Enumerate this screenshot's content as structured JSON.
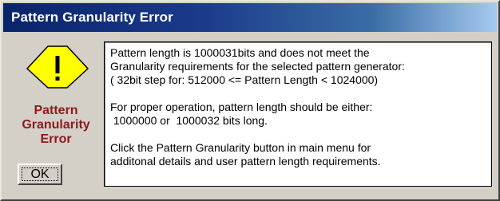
{
  "window": {
    "title": "Pattern Granularity Error"
  },
  "icon": {
    "name": "warning-icon",
    "color": "#ffff00"
  },
  "side_label": "Pattern\nGranularity\nError",
  "ok_button": {
    "label": "OK"
  },
  "message": {
    "paragraph1": [
      "Pattern length is 1000031bits and does not meet the",
      "Granularity requirements for the selected pattern generator:",
      "( 32bit step for: 512000 <= Pattern Length < 1024000)"
    ],
    "paragraph2": [
      "For proper operation, pattern length should be either:",
      " 1000000 or  1000032 bits long."
    ],
    "paragraph3": [
      "Click the Pattern Granularity button in main menu for",
      "additonal details and user pattern length requirements."
    ]
  }
}
